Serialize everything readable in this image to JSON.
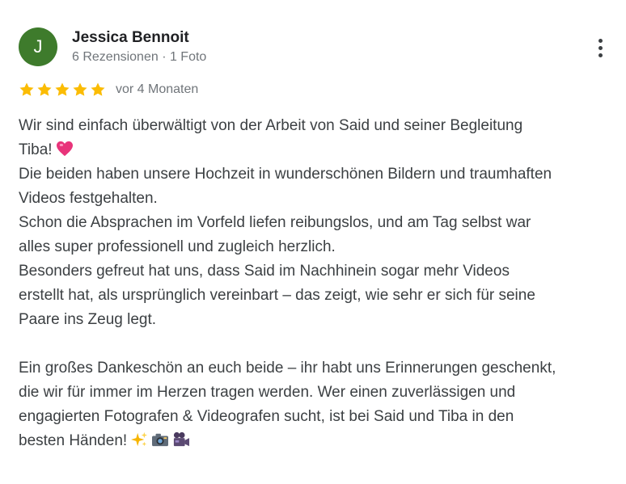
{
  "reviewer": {
    "avatar_letter": "J",
    "avatar_color": "#3e7b2c",
    "name": "Jessica Bennoit",
    "meta": "6 Rezensionen · 1 Foto"
  },
  "menu": {
    "icon": "more-vertical-icon"
  },
  "rating": {
    "stars": 5,
    "max_stars": 5,
    "star_color": "#fbbc04",
    "time": "vor 4 Monaten"
  },
  "review": {
    "line_1": "Wir sind einfach überwältigt von der Arbeit von Said und seiner Begleitung\nTiba!",
    "emoji_1": "heart-emoji-icon",
    "paragraph_1": "Die beiden haben unsere Hochzeit in wunderschönen Bildern und traumhaften\nVideos festgehalten.\nSchon die Absprachen im Vorfeld liefen reibungslos, und am Tag selbst war\nalles super professionell und zugleich herzlich.\nBesonders gefreut hat uns, dass Said im Nachhinein sogar mehr Videos\nerstellt hat, als ursprünglich vereinbart – das zeigt, wie sehr er sich für seine\nPaare ins Zeug legt.\n\nEin großes Dankeschön an euch beide – ihr habt uns Erinnerungen geschenkt,\ndie wir für immer im Herzen tragen werden. Wer einen zuverlässigen und\nengagierten Fotografen & Videografen sucht, ist bei Said und Tiba in den\nbesten Händen!",
    "end_emojis": [
      "sparkles-emoji-icon",
      "camera-emoji-icon",
      "movie-camera-emoji-icon"
    ]
  }
}
